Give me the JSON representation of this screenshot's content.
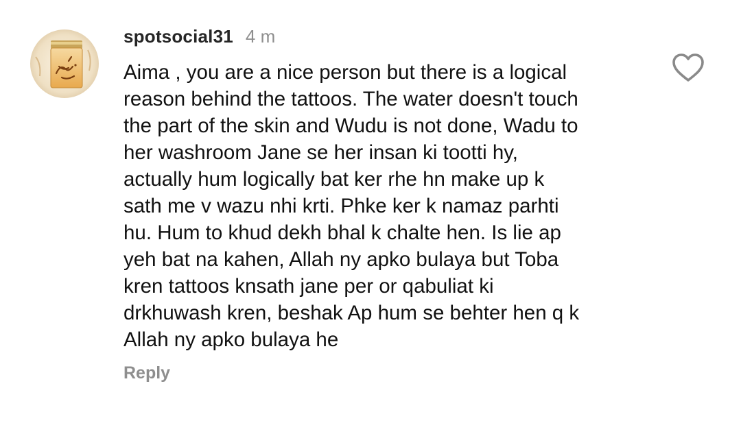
{
  "comment": {
    "avatar_icon": "profile-photo-candle-calligraphy",
    "username": "spotsocial31",
    "time": "4 m",
    "text": "Aima , you are a nice person but there is a logical\nreason behind the tattoos. The water doesn't touch\nthe part of the skin and Wudu is not done, Wadu to\nher washroom Jane se her insan ki tootti hy,\nactually hum logically bat ker rhe hn make up k\nsath me v wazu nhi krti. Phke ker k namaz parhti\nhu. Hum to khud dekh bhal k chalte hen. Is lie ap\nyeh bat na kahen, Allah ny apko bulaya but Toba\nkren tattoos knsath jane per or qabuliat ki\ndrkhuwash kren, beshak Ap hum se behter hen q k\nAllah ny apko bulaya he",
    "reply_label": "Reply",
    "like_icon": "heart-outline-icon"
  },
  "colors": {
    "text": "#111111",
    "username": "#262626",
    "muted": "#8e8e8e",
    "background": "#ffffff"
  }
}
